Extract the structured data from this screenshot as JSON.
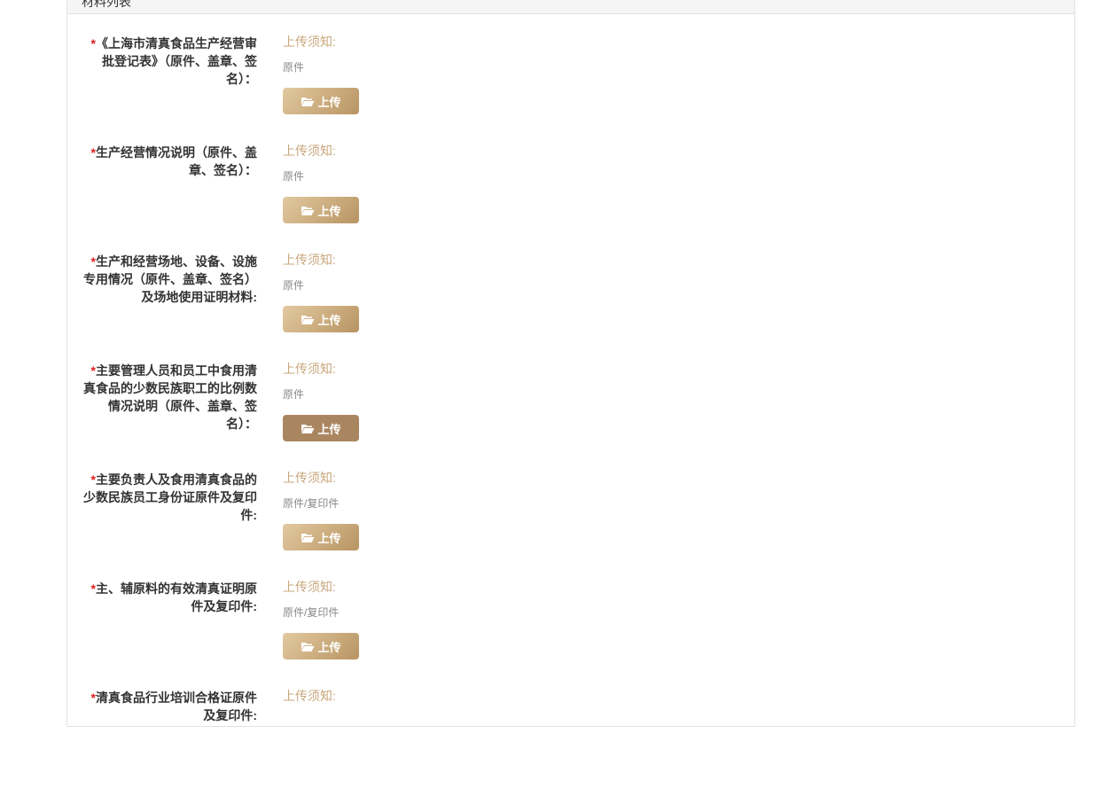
{
  "panel": {
    "title": "材料列表"
  },
  "rows": [
    {
      "required": "*",
      "label": "《上海市清真食品生产经营审批登记表》（原件、盖章、签名）：",
      "notice_title": "上传须知:",
      "notice_text": "原件",
      "button": "上传"
    },
    {
      "required": "*",
      "label": "生产经营情况说明（原件、盖章、签名）：",
      "notice_title": "上传须知:",
      "notice_text": "原件",
      "button": "上传"
    },
    {
      "required": "*",
      "label": "生产和经营场地、设备、设施专用情况（原件、盖章、签名）及场地使用证明材料:",
      "notice_title": "上传须知:",
      "notice_text": "原件",
      "button": "上传"
    },
    {
      "required": "*",
      "label": "主要管理人员和员工中食用清真食品的少数民族职工的比例数情况说明（原件、盖章、签名）：",
      "notice_title": "上传须知:",
      "notice_text": "原件",
      "button": "上传"
    },
    {
      "required": "*",
      "label": "主要负责人及食用清真食品的少数民族员工身份证原件及复印件:",
      "notice_title": "上传须知:",
      "notice_text": "原件/复印件",
      "button": "上传"
    },
    {
      "required": "*",
      "label": "主、辅原料的有效清真证明原件及复印件:",
      "notice_title": "上传须知:",
      "notice_text": "原件/复印件",
      "button": "上传"
    },
    {
      "required": "*",
      "label": "清真食品行业培训合格证原件及复印件:",
      "notice_title": "上传须知:",
      "notice_text": "",
      "button": ""
    }
  ],
  "colors": {
    "accent": "#c9a77c",
    "required": "#e02020",
    "button_active": "#aa8660"
  }
}
